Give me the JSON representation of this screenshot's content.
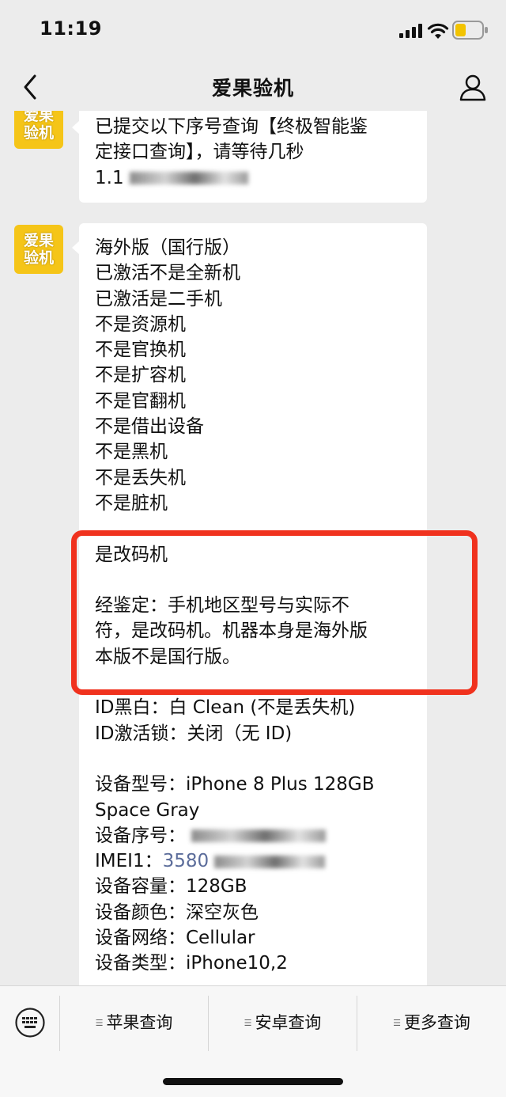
{
  "status_bar": {
    "time": "11:19"
  },
  "header": {
    "title": "爱果验机"
  },
  "avatar_text": {
    "line1": "爱果",
    "line2": "验机"
  },
  "messages": [
    {
      "lines": [
        "已提交以下序号查询【终极智能鉴",
        "定接口查询】，请等待几秒",
        "1.1"
      ]
    },
    {
      "top_lines": [
        "海外版（国行版）",
        "已激活不是全新机",
        "已激活是二手机",
        "不是资源机",
        "不是官换机",
        "不是扩容机",
        "不是官翻机",
        "不是借出设备",
        "不是黑机",
        "不是丢失机",
        "不是脏机"
      ],
      "highlight_lines": [
        "是改码机",
        "",
        "经鉴定：手机地区型号与实际不",
        "符，是改码机。机器本身是海外版",
        "本版不是国行版。"
      ],
      "bottom_lines_a": [
        "ID黑白：白 Clean (不是丢失机)",
        "ID激活锁：关闭（无 ID)"
      ],
      "bottom_lines_b": [
        "设备型号：iPhone 8 Plus 128GB",
        "Space Gray"
      ],
      "serial_label": "设备序号：",
      "imei_label": "IMEI1：",
      "imei_value": "3580",
      "bottom_lines_c": [
        "设备容量：128GB",
        "设备颜色：深空灰色",
        "设备网络：Cellular",
        "设备类型：iPhone10,2"
      ]
    }
  ],
  "menu": {
    "items": [
      "苹果查询",
      "安卓查询",
      "更多查询"
    ]
  },
  "colors": {
    "highlight_border": "#f0321e",
    "avatar_bg": "#f5c518",
    "link": "#5b6c9a"
  }
}
